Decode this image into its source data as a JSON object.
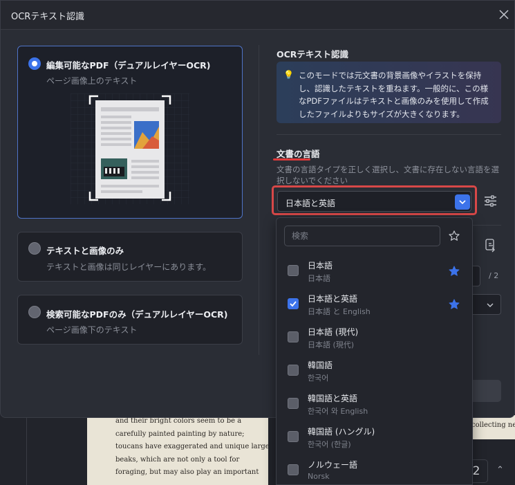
{
  "window": {
    "title": "OCRテキスト認識"
  },
  "modes": [
    {
      "title": "編集可能なPDF（デュアルレイヤーOCR)",
      "subtitle": "ページ画像上のテキスト",
      "selected": true
    },
    {
      "title": "テキストと画像のみ",
      "subtitle": "テキストと画像は同じレイヤーにあります。",
      "selected": false
    },
    {
      "title": "検索可能なPDFのみ（デュアルレイヤーOCR)",
      "subtitle": "ページ画像下のテキスト",
      "selected": false
    }
  ],
  "right_panel": {
    "title": "OCRテキスト認識",
    "info": "このモードでは元文書の背景画像やイラストを保持し、認識したテキストを重ねます。一般的に、この様なPDFファイルはテキストと画像のみを使用して作成したファイルよりもサイズが大きくなります。",
    "language_title": "文書の言語",
    "language_desc": "文書の言語タイプを正しく選択し、文書に存在しない言語を選択しないでください",
    "selected_language": "日本語と英語",
    "page_total": "/ 2"
  },
  "dropdown": {
    "search_placeholder": "検索",
    "items": [
      {
        "name": "日本語",
        "native": "日本語",
        "checked": false,
        "favorite": true
      },
      {
        "name": "日本語と英語",
        "native": "日本語 と English",
        "checked": true,
        "favorite": true
      },
      {
        "name": "日本語 (現代)",
        "native": "日本語 (現代)",
        "checked": false,
        "favorite": false
      },
      {
        "name": "韓国語",
        "native": "한국어",
        "checked": false,
        "favorite": false
      },
      {
        "name": "韓国語と英語",
        "native": "한국어 와 English",
        "checked": false,
        "favorite": false
      },
      {
        "name": "韓国語 (ハングル)",
        "native": "한국어 (한글)",
        "checked": false,
        "favorite": false
      },
      {
        "name": "ノルウェー語",
        "native": "Norsk",
        "checked": false,
        "favorite": false
      }
    ]
  },
  "background_document": {
    "lines": [
      "and their bright colors seem to be a",
      "carefully painted painting by nature;",
      "toucans have exaggerated and unique large",
      "beaks, which are not  only a tool for",
      "foraging, but may also play an important"
    ],
    "right_fragment": "collecting nec",
    "page_number": "2"
  },
  "colors": {
    "accent": "#3c73ea",
    "highlight": "#d84848",
    "favorite_star": "#3c73ea"
  }
}
